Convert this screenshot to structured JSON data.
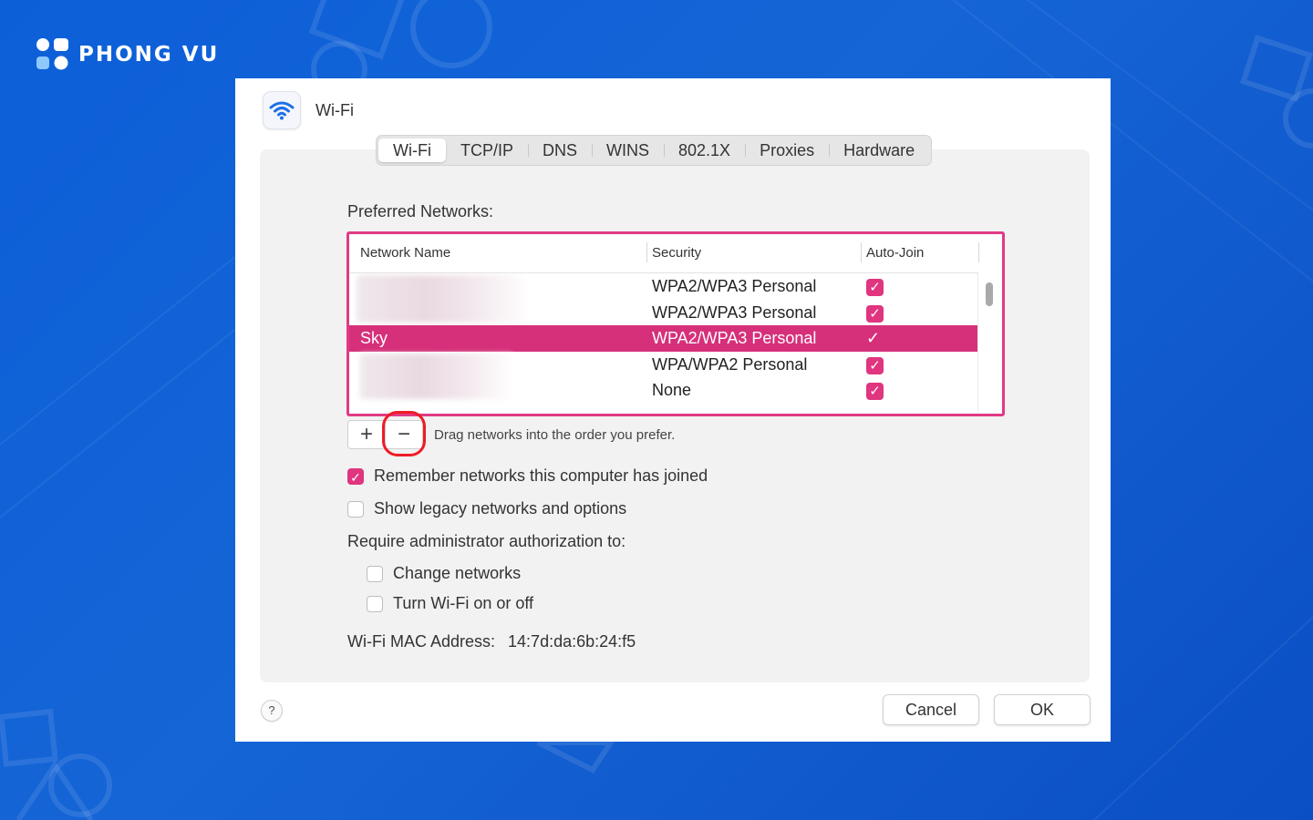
{
  "brand": {
    "name": "PHONG VU"
  },
  "dialog": {
    "title": "Wi-Fi",
    "tabs": [
      {
        "label": "Wi-Fi",
        "active": true
      },
      {
        "label": "TCP/IP",
        "active": false
      },
      {
        "label": "DNS",
        "active": false
      },
      {
        "label": "WINS",
        "active": false
      },
      {
        "label": "802.1X",
        "active": false
      },
      {
        "label": "Proxies",
        "active": false
      },
      {
        "label": "Hardware",
        "active": false
      }
    ],
    "preferred_label": "Preferred Networks:",
    "table": {
      "columns": [
        "Network Name",
        "Security",
        "Auto-Join"
      ],
      "rows": [
        {
          "name": "",
          "security": "WPA2/WPA3 Personal",
          "auto_join": true,
          "selected": false
        },
        {
          "name": "",
          "security": "WPA2/WPA3 Personal",
          "auto_join": true,
          "selected": false
        },
        {
          "name": "Sky",
          "security": "WPA2/WPA3 Personal",
          "auto_join": true,
          "selected": true
        },
        {
          "name": "",
          "security": "WPA/WPA2 Personal",
          "auto_join": true,
          "selected": false
        },
        {
          "name": "",
          "security": "None",
          "auto_join": true,
          "selected": false
        }
      ]
    },
    "add_label": "+",
    "remove_label": "−",
    "drag_hint": "Drag networks into the order you prefer.",
    "remember_networks": {
      "label": "Remember networks this computer has joined",
      "checked": true
    },
    "show_legacy": {
      "label": "Show legacy networks and options",
      "checked": false
    },
    "admin_label": "Require administrator authorization to:",
    "change_networks": {
      "label": "Change networks",
      "checked": false
    },
    "turn_wifi": {
      "label": "Turn Wi-Fi on or off",
      "checked": false
    },
    "mac": {
      "label": "Wi-Fi MAC Address:",
      "value": "14:7d:da:6b:24:f5"
    },
    "help_label": "?",
    "cancel_label": "Cancel",
    "ok_label": "OK"
  },
  "colors": {
    "accent": "#e0357f",
    "selection": "#d6307a",
    "highlight_border": "#e13a86",
    "annotation_ring": "#ee1c25",
    "background": "#1565d6"
  },
  "icons": {
    "title_icon": "wifi-icon",
    "brand_icon": "phong-vu-logo"
  }
}
